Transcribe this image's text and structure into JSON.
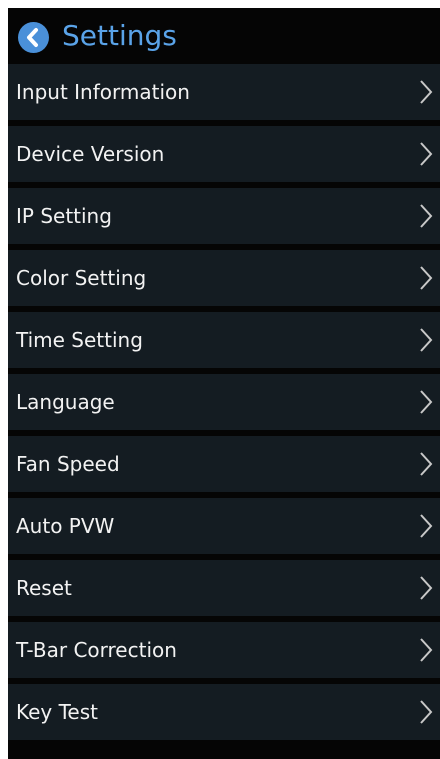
{
  "header": {
    "back_icon": "chevron-left-circle-icon",
    "title": "Settings"
  },
  "menu": {
    "items": [
      {
        "label": "Input Information",
        "icon": "chevron-right-icon"
      },
      {
        "label": "Device Version",
        "icon": "chevron-right-icon"
      },
      {
        "label": "IP Setting",
        "icon": "chevron-right-icon"
      },
      {
        "label": "Color Setting",
        "icon": "chevron-right-icon"
      },
      {
        "label": "Time Setting",
        "icon": "chevron-right-icon"
      },
      {
        "label": "Language",
        "icon": "chevron-right-icon"
      },
      {
        "label": "Fan Speed",
        "icon": "chevron-right-icon"
      },
      {
        "label": "Auto PVW",
        "icon": "chevron-right-icon"
      },
      {
        "label": "Reset",
        "icon": "chevron-right-icon"
      },
      {
        "label": "T-Bar Correction",
        "icon": "chevron-right-icon"
      },
      {
        "label": "Key Test",
        "icon": "chevron-right-icon"
      }
    ]
  },
  "colors": {
    "background": "#050505",
    "row": "#141c22",
    "accent": "#4a90d9",
    "title": "#5aa3e8",
    "text": "#f2f2f2",
    "chevron": "#c8c8c8"
  }
}
